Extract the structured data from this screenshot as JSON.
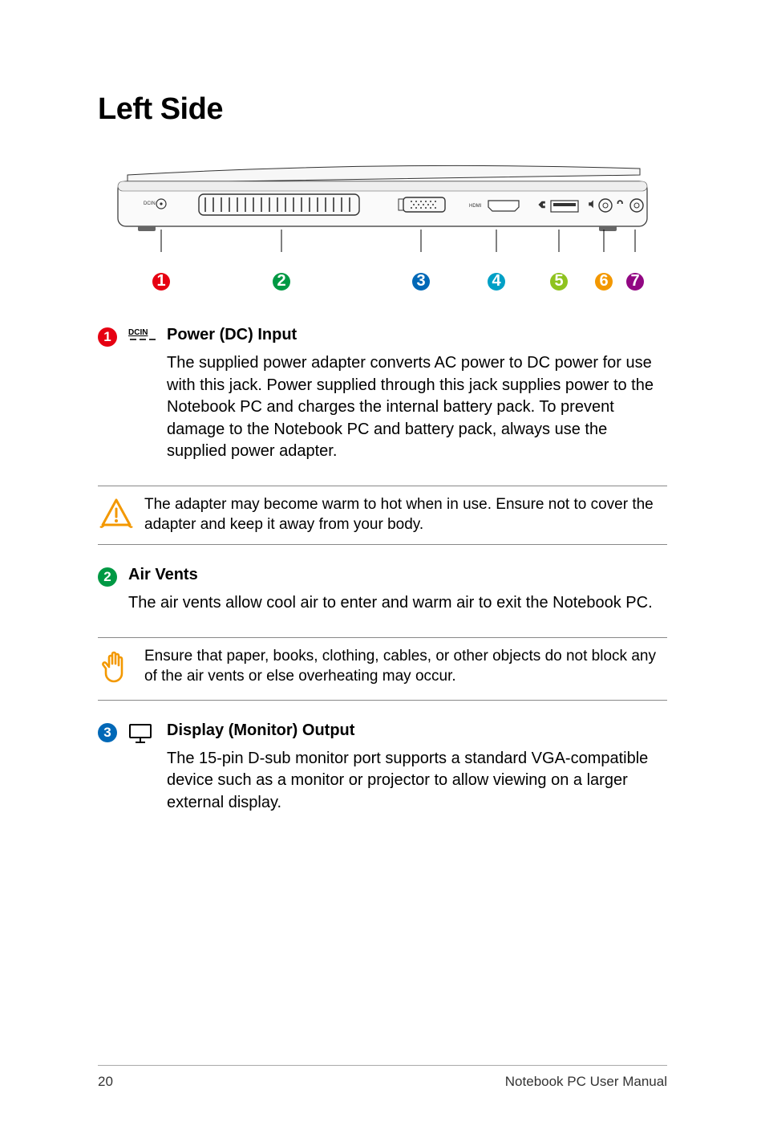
{
  "heading": "Left Side",
  "callouts": [
    "1",
    "2",
    "3",
    "4",
    "5",
    "6",
    "7"
  ],
  "sections": {
    "s1": {
      "num": "1",
      "title": "Power (DC) Input",
      "body": "The supplied power adapter converts AC power to DC power for use with this jack. Power supplied through this jack supplies power to the Notebook PC and charges the internal battery pack. To prevent damage to the Notebook PC and battery pack, always use the supplied power adapter."
    },
    "note1": "The adapter may become warm to hot when in use. Ensure not to cover the adapter and keep it away from your body.",
    "s2": {
      "num": "2",
      "title": "Air Vents",
      "body": "The air vents allow cool air to enter and warm air to exit the Notebook PC."
    },
    "note2": "Ensure that paper, books, clothing, cables, or other objects do not block any of the air vents or else overheating may occur.",
    "s3": {
      "num": "3",
      "title": "Display (Monitor) Output",
      "body": "The 15-pin D-sub monitor port supports a standard VGA-compatible device such as a monitor or projector to allow viewing on a larger external display."
    }
  },
  "icons": {
    "dcin_label": "DCIN"
  },
  "footer": {
    "page": "20",
    "title": "Notebook PC User Manual"
  }
}
